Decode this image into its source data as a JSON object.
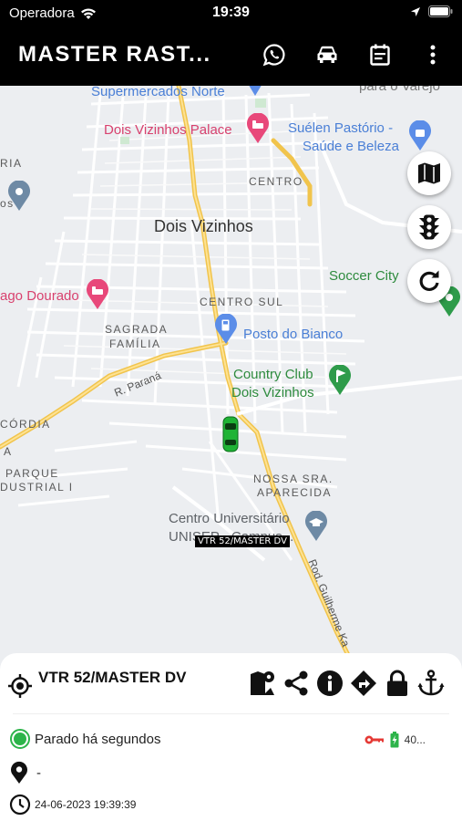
{
  "status_bar": {
    "carrier": "Operadora",
    "time": "19:39"
  },
  "app_bar": {
    "title": "MASTER RAST...",
    "icons": [
      "whatsapp-icon",
      "car-icon",
      "calendar-icon",
      "more-icon"
    ]
  },
  "map": {
    "labels": {
      "supermercados": "Supermercados Norte",
      "para_o_varejo": "para o Varejo",
      "dois_vizinhos_palace": "Dois Vizinhos Palace",
      "suelen_1": "Suélen Pastório -",
      "suelen_2": "Saúde e Beleza",
      "ria": "RIA",
      "os": "os",
      "centro": "CENTRO",
      "dois_vizinhos": "Dois Vizinhos",
      "soccer_city": "Soccer City",
      "ago_dourado": "ago Dourado",
      "centro_sul": "CENTRO SUL",
      "sagrada": "SAGRADA",
      "familia": "FAMÍLIA",
      "posto": "Posto do Bianco",
      "country_1": "Country Club",
      "country_2": "Dois Vizinhos",
      "r_parana": "R. Paraná",
      "cordia": "CÓRDIA",
      "a": "A",
      "parque": "PARQUE",
      "dustrial": "DUSTRIAL I",
      "nossa_sra": "NOSSA SRA.",
      "aparecida": "APARECIDA",
      "centro_univ_1": "Centro Universitário",
      "centro_univ_2": "UNISEP - Campus...",
      "rod": "Rod. Guilherme Ka"
    },
    "vehicle_tag": "VTR 52/MASTER DV",
    "vehicle_color": "#1fb335",
    "controls": [
      "map-layers-icon",
      "traffic-light-icon",
      "refresh-icon"
    ]
  },
  "sheet": {
    "vehicle_name": "VTR 52/MASTER DV",
    "status_text": "Parado há segundos",
    "address": "-",
    "timestamp": "24-06-2023 19:39:39",
    "battery_text": "40...",
    "status_color": "#2db44a",
    "key_color": "#e53935",
    "battery_color": "#2db44a",
    "tools": [
      "route-history-icon",
      "share-icon",
      "info-icon",
      "directions-icon",
      "lock-icon",
      "anchor-icon"
    ]
  }
}
